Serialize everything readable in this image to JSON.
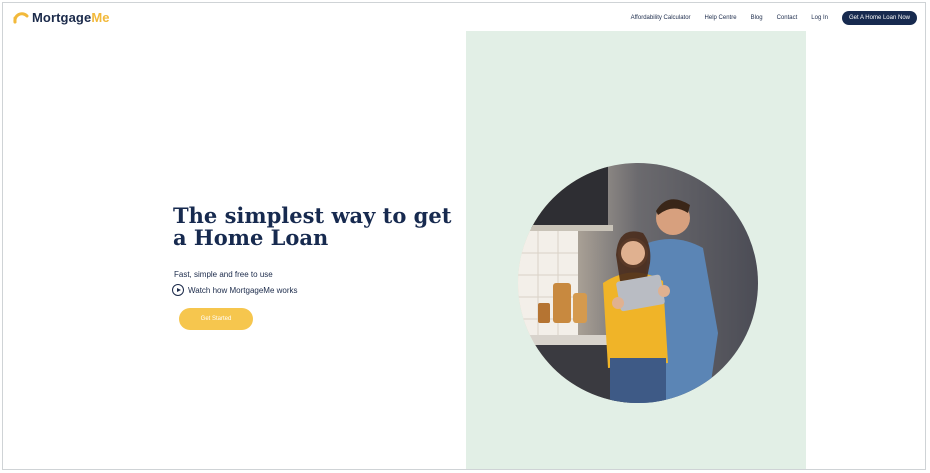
{
  "brand": {
    "name_part1": "Mortgage",
    "name_part2": "Me",
    "accent_color": "#f2b93b",
    "primary_color": "#172a4f"
  },
  "nav": {
    "items": [
      {
        "label": "Affordability Calculator"
      },
      {
        "label": "Help Centre"
      },
      {
        "label": "Blog"
      },
      {
        "label": "Contact"
      },
      {
        "label": "Log In"
      }
    ],
    "cta_label": "Get A Home Loan Now"
  },
  "hero": {
    "headline": "The simplest way to get a Home Loan",
    "subtitle": "Fast, simple and free to use",
    "watch_label": "Watch how MortgageMe works",
    "get_started_label": "Get Started",
    "panel_color": "#e2efe6",
    "button_color": "#f6c64e"
  },
  "icons": {
    "logo": "logo-arc-icon",
    "play": "play-circle-icon"
  }
}
